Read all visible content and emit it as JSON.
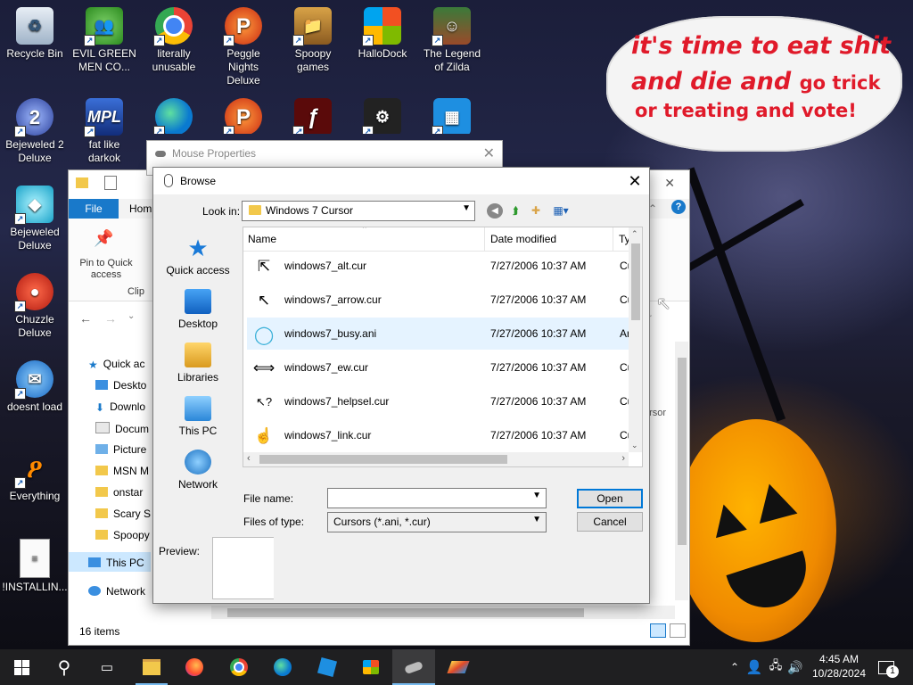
{
  "desktop": {
    "icons": [
      {
        "label": "Recycle Bin",
        "icon": "recycle-bin-icon"
      },
      {
        "label": "EVIL GREEN MEN CO...",
        "icon": "msn-messenger-icon"
      },
      {
        "label": "literally unusable",
        "icon": "chrome-icon"
      },
      {
        "label": "Peggle Nights Deluxe",
        "icon": "peggle-icon"
      },
      {
        "label": "Spoopy games",
        "icon": "folder-icon"
      },
      {
        "label": "HalloDock",
        "icon": "windows-logo-icon"
      },
      {
        "label": "The Legend of Zilda",
        "icon": "game-character-icon"
      },
      {
        "label": "Bejeweled 2 Deluxe",
        "icon": "bejeweled2-icon"
      },
      {
        "label": "fat like darkok",
        "icon": "mpl-icon"
      },
      {
        "label": "Bejeweled Deluxe",
        "icon": "diamond-icon"
      },
      {
        "label": "Chuzzle Deluxe",
        "icon": "chuzzle-icon"
      },
      {
        "label": "doesnt load",
        "icon": "thunderbird-icon"
      },
      {
        "label": "Everything",
        "icon": "search-icon"
      },
      {
        "label": "!INSTALLIN...",
        "icon": "text-file-icon"
      }
    ],
    "speech_bubble": {
      "line1": "it's time to eat shit",
      "line2a": "and die and ",
      "line2b": "go trick",
      "line3": "or treating and vote!"
    }
  },
  "explorer": {
    "file_tab": "File",
    "home_tab": "Hom",
    "pin_label": "Pin to Quick access",
    "clipboard_label": "Clip",
    "nav": [
      {
        "label": "Quick ac"
      },
      {
        "label": "Deskto"
      },
      {
        "label": "Downlo"
      },
      {
        "label": "Docum"
      },
      {
        "label": "Picture"
      },
      {
        "label": "MSN M"
      },
      {
        "label": "onstar"
      },
      {
        "label": "Scary S"
      },
      {
        "label": "Spoopy"
      },
      {
        "label": "This PC"
      },
      {
        "label": "Network"
      }
    ],
    "status": "16 items",
    "partial_right": "r",
    "partial_cursor": "ursor"
  },
  "mouse_properties": {
    "title": "Mouse Properties"
  },
  "browse": {
    "title": "Browse",
    "look_in_label": "Look in:",
    "look_in_value": "Windows 7 Cursor",
    "places": [
      {
        "label": "Quick access",
        "icon": "star-icon"
      },
      {
        "label": "Desktop",
        "icon": "desktop-icon"
      },
      {
        "label": "Libraries",
        "icon": "libraries-icon"
      },
      {
        "label": "This PC",
        "icon": "computer-icon"
      },
      {
        "label": "Network",
        "icon": "network-icon"
      }
    ],
    "columns": {
      "name": "Name",
      "date": "Date modified",
      "type": "Ty"
    },
    "files": [
      {
        "name": "windows7_alt.cur",
        "date": "7/27/2006 10:37 AM",
        "type": "Cu",
        "icon": "alt-cursor-icon",
        "glyph": "⇱"
      },
      {
        "name": "windows7_arrow.cur",
        "date": "7/27/2006 10:37 AM",
        "type": "Cu",
        "icon": "arrow-cursor-icon",
        "glyph": "↖"
      },
      {
        "name": "windows7_busy.ani",
        "date": "7/27/2006 10:37 AM",
        "type": "An",
        "icon": "busy-ring-icon",
        "glyph": "◯"
      },
      {
        "name": "windows7_ew.cur",
        "date": "7/27/2006 10:37 AM",
        "type": "Cu",
        "icon": "ew-resize-cursor-icon",
        "glyph": "⟺"
      },
      {
        "name": "windows7_helpsel.cur",
        "date": "7/27/2006 10:37 AM",
        "type": "Cu",
        "icon": "help-cursor-icon",
        "glyph": "↖?"
      },
      {
        "name": "windows7_link.cur",
        "date": "7/27/2006 10:37 AM",
        "type": "Cu",
        "icon": "hand-cursor-icon",
        "glyph": "☝"
      }
    ],
    "file_name_label": "File name:",
    "file_name_value": "",
    "files_of_type_label": "Files of type:",
    "files_of_type_value": "Cursors (*.ani, *.cur)",
    "open_button": "Open",
    "cancel_button": "Cancel",
    "preview_label": "Preview:"
  },
  "taskbar": {
    "time": "4:45 AM",
    "date": "10/28/2024",
    "notification_count": "1",
    "apps": [
      "file-explorer-icon",
      "firefox-icon",
      "chrome-icon",
      "edge-icon",
      "roblox-studio-icon",
      "store-icon",
      "mouse-icon",
      "app-icon"
    ]
  },
  "colors": {
    "accent": "#0078d7",
    "file_tab": "#1979ca",
    "bubble_text": "#e01a2a",
    "taskbar": "#1f1f21",
    "selection": "#e5f3ff"
  }
}
